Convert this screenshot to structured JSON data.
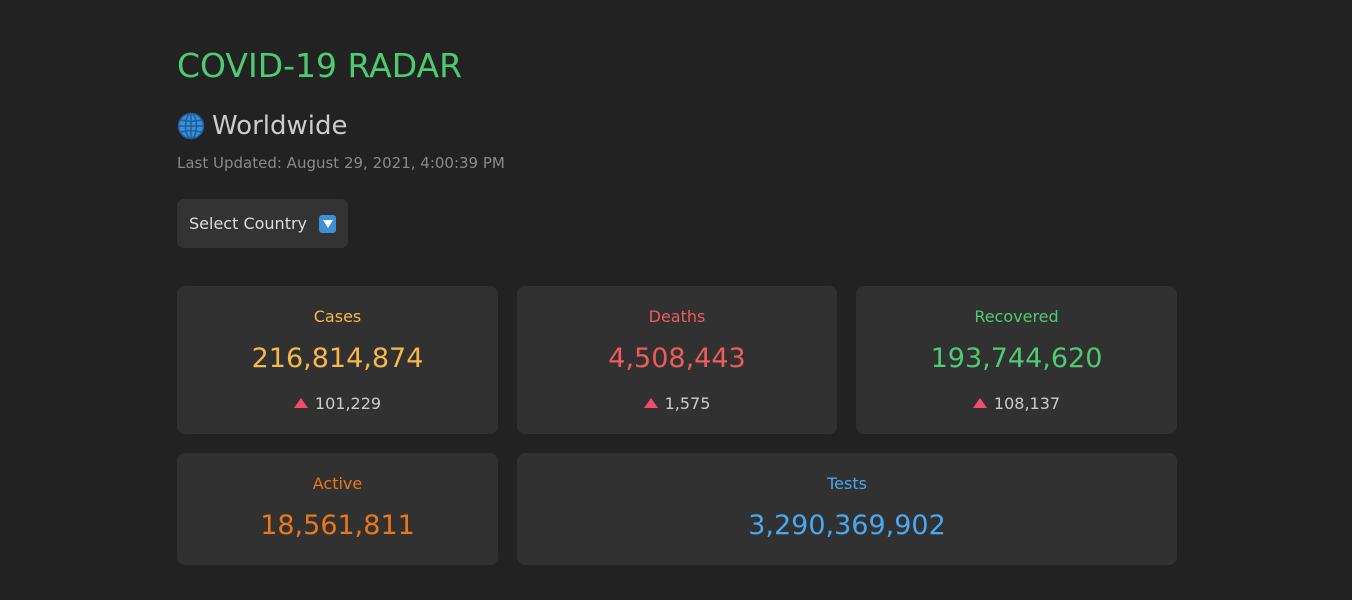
{
  "app": {
    "title": "COVID-19 RADAR"
  },
  "region": {
    "name": "Worldwide",
    "icon": "globe-icon"
  },
  "last_updated": "Last Updated: August 29, 2021, 4:00:39 PM",
  "select_country": {
    "label": "Select Country",
    "icon": "dropdown-arrow-icon"
  },
  "colors": {
    "background": "#222222",
    "card": "#313131",
    "title": "#4ecb71",
    "cases": "#f7b84b",
    "deaths": "#ef5b5b",
    "recovered": "#4ecb71",
    "active": "#e8771e",
    "tests": "#4aa8f0",
    "delta_arrow": "#ef4f6a"
  },
  "stats": {
    "cases": {
      "label": "Cases",
      "value": "216,814,874",
      "delta": "101,229"
    },
    "deaths": {
      "label": "Deaths",
      "value": "4,508,443",
      "delta": "1,575"
    },
    "recovered": {
      "label": "Recovered",
      "value": "193,744,620",
      "delta": "108,137"
    },
    "active": {
      "label": "Active",
      "value": "18,561,811"
    },
    "tests": {
      "label": "Tests",
      "value": "3,290,369,902"
    }
  }
}
